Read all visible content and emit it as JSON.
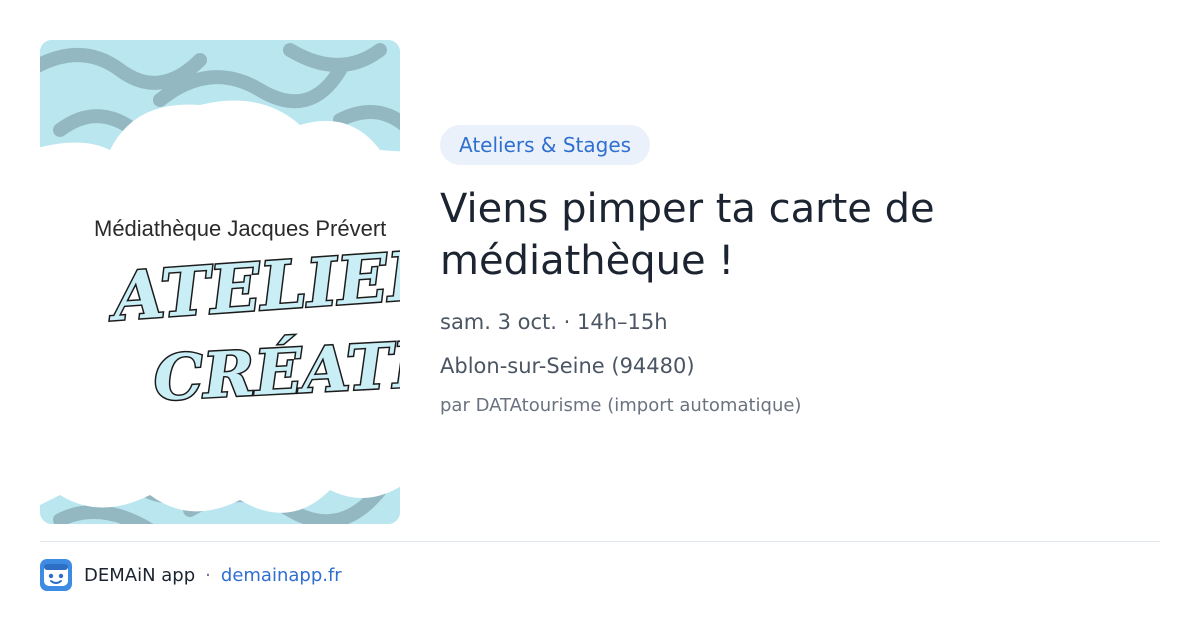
{
  "card": {
    "image": {
      "kind": "event-poster",
      "line1": "Médiathèque Jacques Prévert",
      "line2": "ATELIERS",
      "line3": "CRÉATIFS",
      "colors": {
        "background": "#b9e6ef",
        "squiggles": "#93b8c2",
        "cloud": "#ffffff"
      }
    },
    "category": "Ateliers & Stages",
    "title": "Viens pimper ta carte de médiathèque !",
    "date": "sam. 3 oct. · 14h–15h",
    "location": "Ablon-sur-Seine (94480)",
    "source": "par DATAtourisme (import automatique)"
  },
  "footer": {
    "app_icon": "demain-app-icon",
    "app_name": "DEMAiN app",
    "separator": "·",
    "link": "demainapp.fr"
  },
  "colors": {
    "accent": "#2f6fd0",
    "badge_bg": "#eaf1fa",
    "title": "#1b2430",
    "body_text": "#4b5563",
    "muted_text": "#6b7280"
  }
}
